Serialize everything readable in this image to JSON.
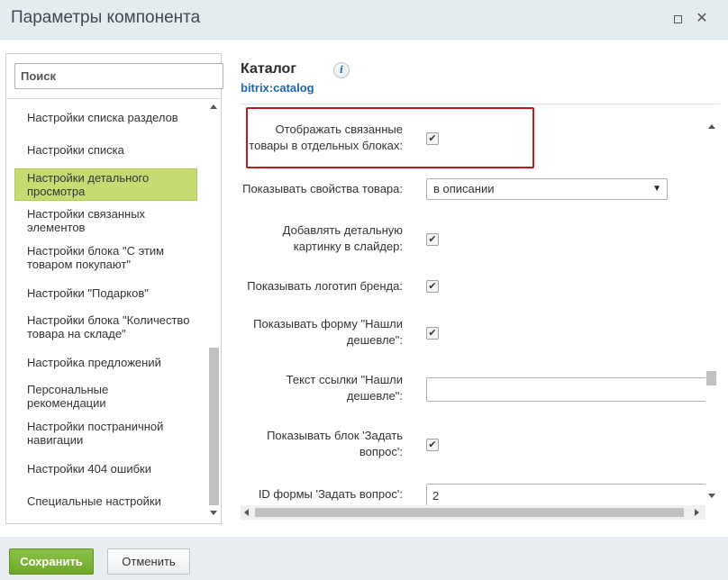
{
  "window": {
    "title": "Параметры компонента",
    "maximize_icon": "maximize-icon",
    "close_icon": "close-icon",
    "close_glyph": "✕"
  },
  "sidebar": {
    "search_placeholder": "Поиск",
    "items": [
      {
        "label": "Настройки списка разделов",
        "active": false
      },
      {
        "label": "Настройки списка",
        "active": false
      },
      {
        "label": "Настройки детального просмотра",
        "active": true
      },
      {
        "label": "Настройки связанных элементов",
        "active": false
      },
      {
        "label": "Настройки блока \"С этим товаром покупают\"",
        "active": false
      },
      {
        "label": "Настройки \"Подарков\"",
        "active": false
      },
      {
        "label": "Настройки блока \"Количество товара на складе\"",
        "active": false
      },
      {
        "label": "Настройка предложений",
        "active": false
      },
      {
        "label": "Персональные рекомендации",
        "active": false
      },
      {
        "label": "Настройки постраничной навигации",
        "active": false
      },
      {
        "label": "Настройки 404 ошибки",
        "active": false
      },
      {
        "label": "Специальные настройки",
        "active": false
      }
    ]
  },
  "component": {
    "title": "Каталог",
    "code": "bitrix:catalog",
    "info_glyph": "i"
  },
  "params": [
    {
      "label": "Отображать связанные товары в отдельных блоках:",
      "type": "checkbox",
      "checked": true,
      "highlighted": true
    },
    {
      "label": "Показывать свойства товара:",
      "type": "select",
      "value": "в описании"
    },
    {
      "label": "Добавлять детальную картинку в слайдер:",
      "type": "checkbox",
      "checked": true
    },
    {
      "label": "Показывать логотип бренда:",
      "type": "checkbox",
      "checked": true
    },
    {
      "label": "Показывать форму \"Нашли дешевле\":",
      "type": "checkbox",
      "checked": true
    },
    {
      "label": "Текст ссылки \"Нашли дешевле\":",
      "type": "text",
      "value": ""
    },
    {
      "label": "Показывать блок 'Задать вопрос':",
      "type": "checkbox",
      "checked": true
    },
    {
      "label": "ID формы 'Задать вопрос':",
      "type": "text",
      "value": "2"
    }
  ],
  "labels": {
    "p0_l1": "Отображать связанные",
    "p0_l2": "товары в отдельных блоках:",
    "p2_l1": "Добавлять детальную",
    "p2_l2": "картинку в слайдер:",
    "p4_l1": "Показывать форму \"Нашли",
    "p4_l2": "дешевле\":",
    "p5_l1": "Текст ссылки \"Нашли",
    "p5_l2": "дешевле\":",
    "p6_l1": "Показывать блок 'Задать",
    "p6_l2": "вопрос':",
    "nav2_l1": "Настройки детального",
    "nav2_l2": "просмотра",
    "nav3_l1": "Настройки связанных",
    "nav3_l2": "элементов",
    "nav4_l1": "Настройки блока \"С этим",
    "nav4_l2": "товаром покупают\"",
    "nav6_l1": "Настройки блока \"Количество",
    "nav6_l2": "товара на складе\"",
    "nav8_l1": "Персональные",
    "nav8_l2": "рекомендации",
    "nav9_l1": "Настройки постраничной",
    "nav9_l2": "навигации"
  },
  "glyphs": {
    "check": "✔",
    "dropdown": "▼"
  },
  "footer": {
    "save_label": "Сохранить",
    "cancel_label": "Отменить"
  },
  "colors": {
    "active_nav": "#c6dc73",
    "save_button": "#7bb33a",
    "highlight_border": "#c0181e",
    "component_code": "#2067b0"
  }
}
